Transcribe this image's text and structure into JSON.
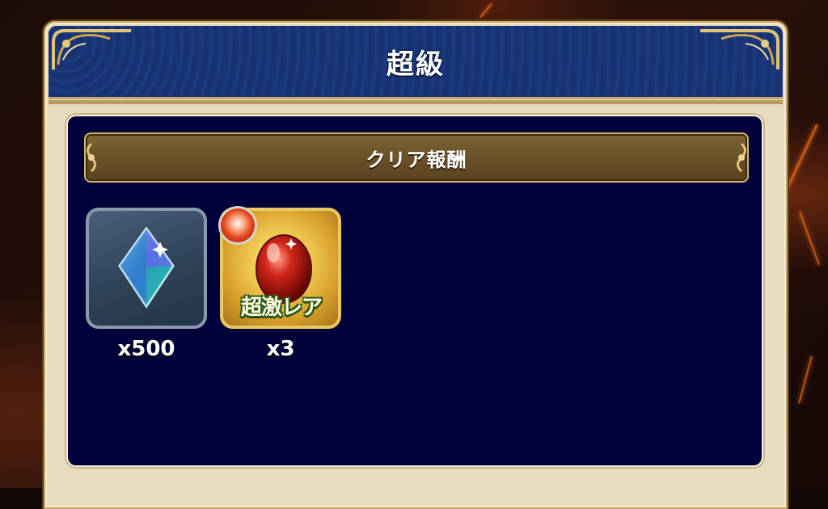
{
  "header": {
    "title": "超級"
  },
  "section": {
    "title": "クリア報酬"
  },
  "rewards": [
    {
      "icon": "crystal-icon",
      "count": "x500"
    },
    {
      "icon": "red-egg-icon",
      "badge": "fire-element-icon",
      "rarity_label": "超激レア",
      "count": "x3"
    }
  ],
  "colors": {
    "header_bg": "#183474",
    "panel_bg": "#e8dcbf",
    "inner_bg": "#02023a",
    "section_bar": "#6a5128",
    "gold_trim": "#c9a760"
  }
}
